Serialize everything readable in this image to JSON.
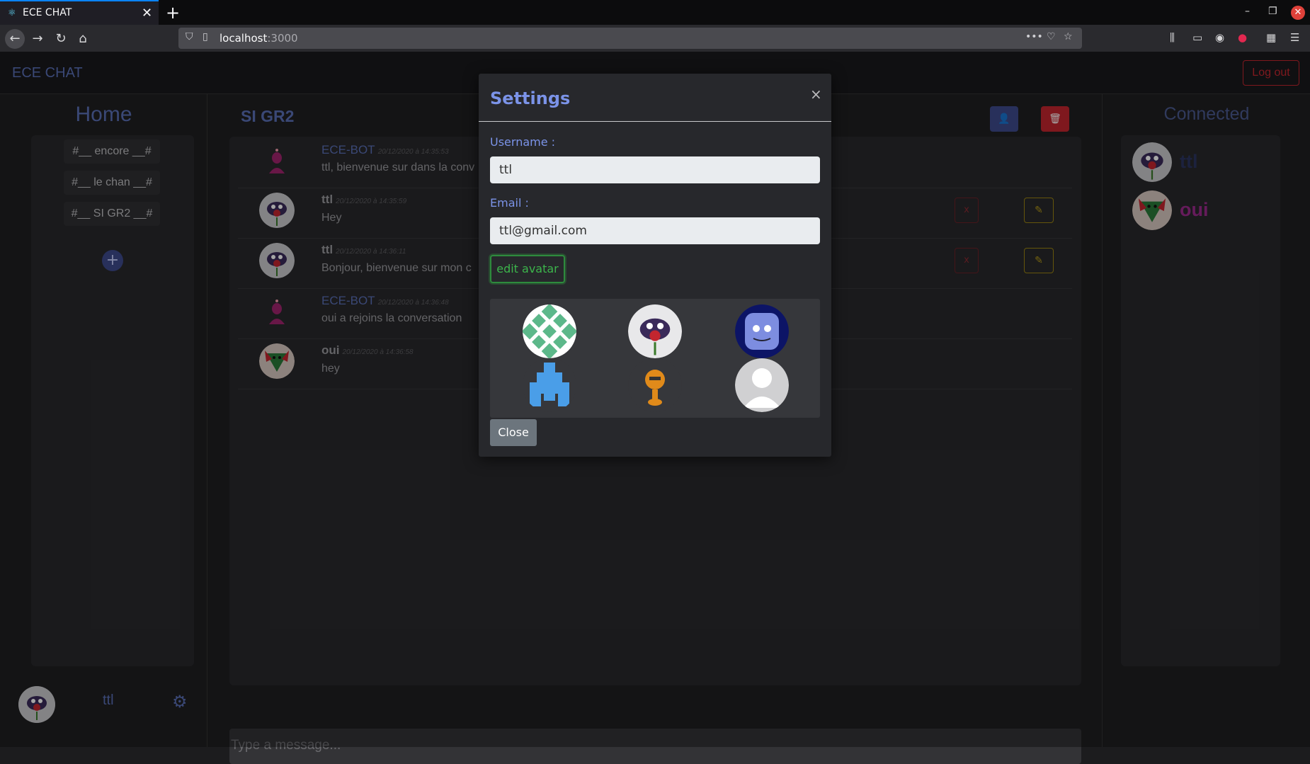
{
  "browser": {
    "tab_title": "ECE CHAT",
    "tab_close": "✕",
    "new_tab": "+",
    "url_host": "localhost",
    "url_port": ":3000"
  },
  "app": {
    "brand": "ECE CHAT",
    "logout_label": "Log out",
    "home_title": "Home",
    "channels": [
      "#__ encore __#",
      "#__ le chan __#",
      "#__ SI GR2 __#"
    ],
    "add_channel": "+",
    "current_user": "ttl",
    "channel_title": "SI GR2",
    "connected_title": "Connected",
    "connected_users": [
      {
        "name": "ttl",
        "color": "#2b3560"
      },
      {
        "name": "oui",
        "color": "#9b2a8c"
      }
    ],
    "composer_placeholder": "Type a message...",
    "delete_label": "x",
    "messages": [
      {
        "author": "ECE-BOT",
        "time": "20/12/2020 à 14:35:53",
        "text": "ttl, bienvenue sur dans la conv"
      },
      {
        "author": "ttl",
        "time": "20/12/2020 à 14:35:59",
        "text": "Hey"
      },
      {
        "author": "ttl",
        "time": "20/12/2020 à 14:36:11",
        "text": "Bonjour, bienvenue sur mon c"
      },
      {
        "author": "ECE-BOT",
        "time": "20/12/2020 à 14:36:48",
        "text": "oui a rejoins la conversation"
      },
      {
        "author": "oui",
        "time": "20/12/2020 à 14:36:58",
        "text": "hey"
      }
    ]
  },
  "modal": {
    "title": "Settings",
    "close_x": "×",
    "username_label": "Username :",
    "username_value": "ttl",
    "email_label": "Email :",
    "email_value": "ttl@gmail.com",
    "edit_avatar_label": "edit avatar",
    "close_label": "Close"
  },
  "colors": {
    "accent": "#5a6fb6",
    "danger": "#c3262f",
    "warning": "#b59a17",
    "success": "#3cb44b"
  }
}
